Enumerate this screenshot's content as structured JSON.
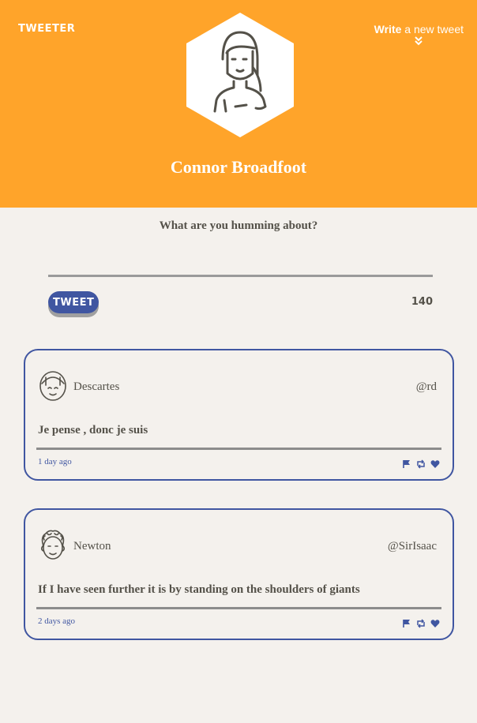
{
  "header": {
    "brand": "TWEETER",
    "compose_bold": "Write",
    "compose_rest": " a new tweet",
    "compose_arrow": "»",
    "user_name": "Connor Broadfoot"
  },
  "composer": {
    "prompt": "What are you humming about?",
    "input_value": "",
    "button_label": "TWEET",
    "counter": "140"
  },
  "tweets": [
    {
      "name": "Descartes",
      "handle": "@rd",
      "text": "Je pense , donc je suis",
      "time": "1 day ago"
    },
    {
      "name": "Newton",
      "handle": "@SirIsaac",
      "text": "If I have seen further it is by standing on the shoulders of giants",
      "time": "2 days ago"
    }
  ],
  "colors": {
    "header_bg": "#ffa42a",
    "page_bg": "#f4f1ed",
    "accent": "#4056a1",
    "text": "#545149"
  },
  "icons": [
    "flag-icon",
    "retweet-icon",
    "heart-icon"
  ]
}
